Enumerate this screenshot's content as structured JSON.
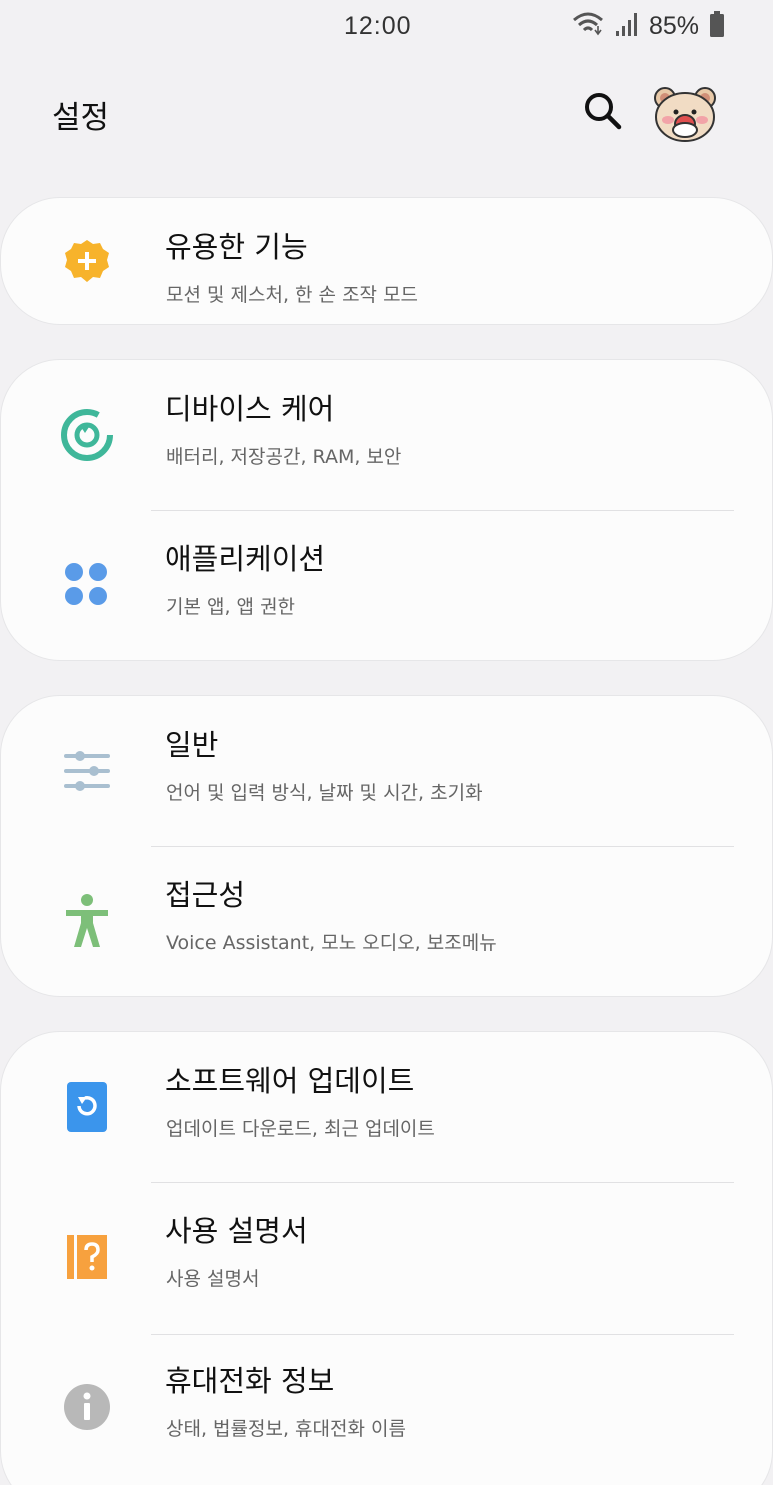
{
  "status_bar": {
    "time": "12:00",
    "battery_percent": "85%",
    "icons": [
      "wifi-icon",
      "signal-icon",
      "battery-icon"
    ]
  },
  "header": {
    "title": "설정",
    "search_icon": "search-icon",
    "avatar_icon": "bear-avatar"
  },
  "colors": {
    "background": "#f2f1f3",
    "card": "#fcfcfc",
    "advanced_features": "#f7b32b",
    "device_care": "#3fb79a",
    "apps": "#5a9be8",
    "general": "#a9bfd0",
    "accessibility": "#7dbf79",
    "software_update": "#3b95ec",
    "user_manual": "#f7a13e",
    "about_phone": "#b8b8b8"
  },
  "groups": [
    {
      "items": [
        {
          "title": "유용한 기능",
          "subtitle": "모션 및 제스처, 한 손 조작 모드",
          "icon": "gear-plus-icon"
        }
      ]
    },
    {
      "items": [
        {
          "title": "디바이스 케어",
          "subtitle": "배터리, 저장공간, RAM, 보안",
          "icon": "device-care-icon"
        },
        {
          "title": "애플리케이션",
          "subtitle": "기본 앱, 앱 권한",
          "icon": "apps-grid-icon"
        }
      ]
    },
    {
      "items": [
        {
          "title": "일반",
          "subtitle": "언어 및 입력 방식, 날짜 및 시간, 초기화",
          "icon": "sliders-icon"
        },
        {
          "title": "접근성",
          "subtitle": "Voice Assistant, 모노 오디오, 보조메뉴",
          "icon": "accessibility-icon"
        }
      ]
    },
    {
      "items": [
        {
          "title": "소프트웨어 업데이트",
          "subtitle": "업데이트 다운로드, 최근 업데이트",
          "icon": "software-update-icon"
        },
        {
          "title": "사용 설명서",
          "subtitle": "사용 설명서",
          "icon": "user-manual-icon"
        },
        {
          "title": "휴대전화 정보",
          "subtitle": "상태, 법률정보, 휴대전화 이름",
          "icon": "info-icon"
        }
      ]
    }
  ]
}
